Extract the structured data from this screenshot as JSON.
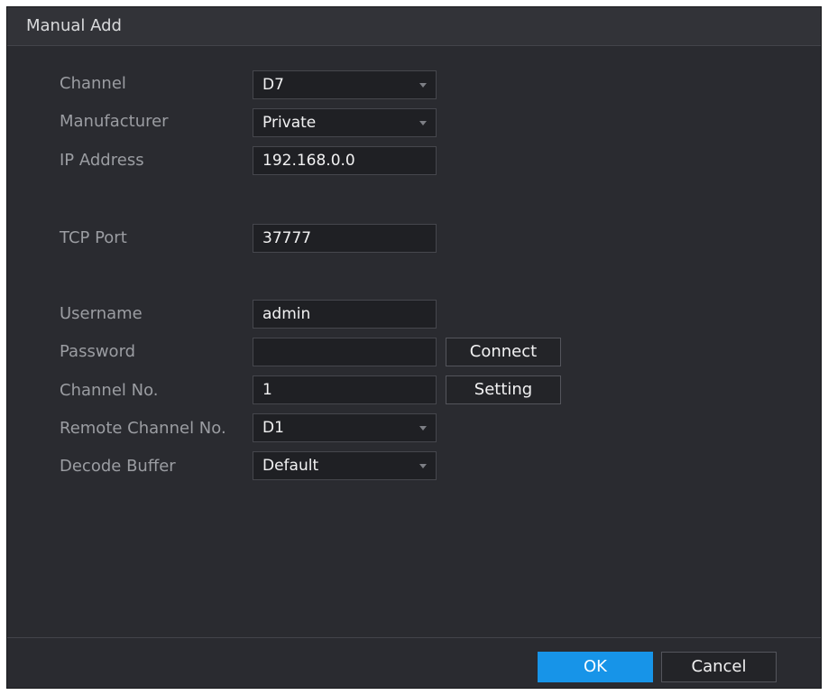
{
  "dialog": {
    "title": "Manual Add"
  },
  "form": {
    "channel": {
      "label": "Channel",
      "value": "D7"
    },
    "manufacturer": {
      "label": "Manufacturer",
      "value": "Private"
    },
    "ip_address": {
      "label": "IP Address",
      "value": "192.168.0.0"
    },
    "tcp_port": {
      "label": "TCP Port",
      "value": "37777"
    },
    "username": {
      "label": "Username",
      "value": "admin"
    },
    "password": {
      "label": "Password",
      "value": ""
    },
    "channel_no": {
      "label": "Channel No.",
      "value": "1"
    },
    "remote_channel_no": {
      "label": "Remote Channel No.",
      "value": "D1"
    },
    "decode_buffer": {
      "label": "Decode Buffer",
      "value": "Default"
    }
  },
  "buttons": {
    "connect": "Connect",
    "setting": "Setting",
    "ok": "OK",
    "cancel": "Cancel"
  },
  "icons": {
    "dropdown": "chevron-down-icon"
  },
  "colors": {
    "accent": "#1794e8",
    "background": "#2a2b30",
    "field_background": "#1f2024"
  }
}
